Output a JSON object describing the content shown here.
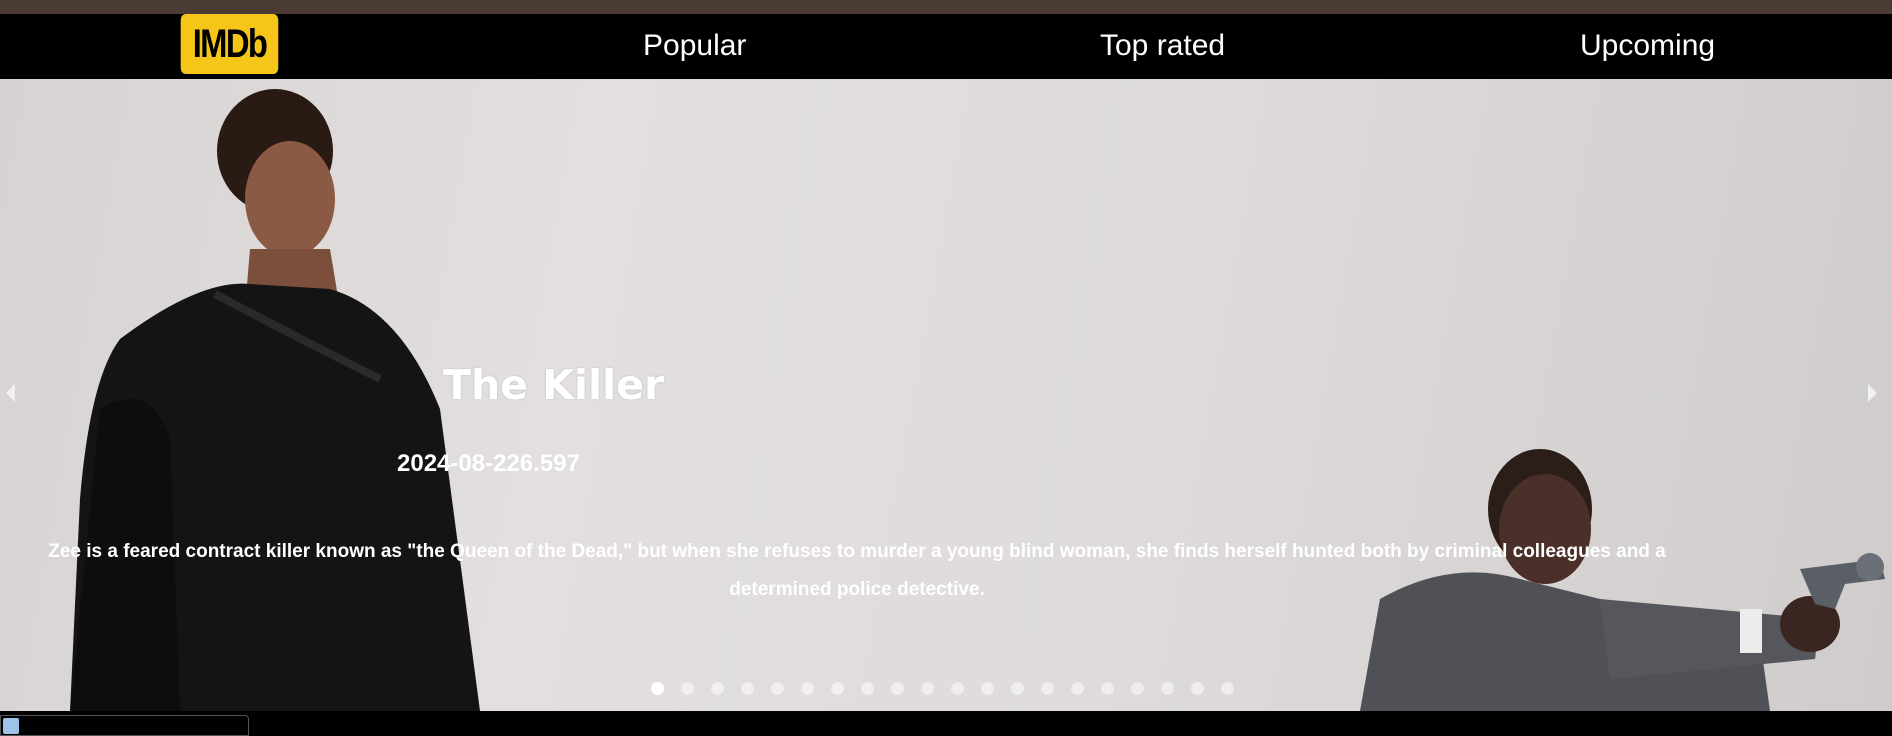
{
  "nav": {
    "logo": "IMDb",
    "links": [
      "Popular",
      "Top rated",
      "Upcoming"
    ]
  },
  "hero": {
    "title": "The Killer",
    "meta": "2024-08-226.597",
    "description": "Zee is a feared contract killer known as \"the Queen of the Dead,\" but when she refuses to murder a young blind woman, she finds herself hunted both by criminal colleagues and a determined police detective.",
    "slide_count": 20,
    "active_slide": 1
  },
  "icons": {
    "prev": "chevron-left-icon",
    "next": "chevron-right-icon"
  },
  "colors": {
    "brand": "#f5c518",
    "navbar": "#000000",
    "topstrip": "#4a3c35"
  }
}
